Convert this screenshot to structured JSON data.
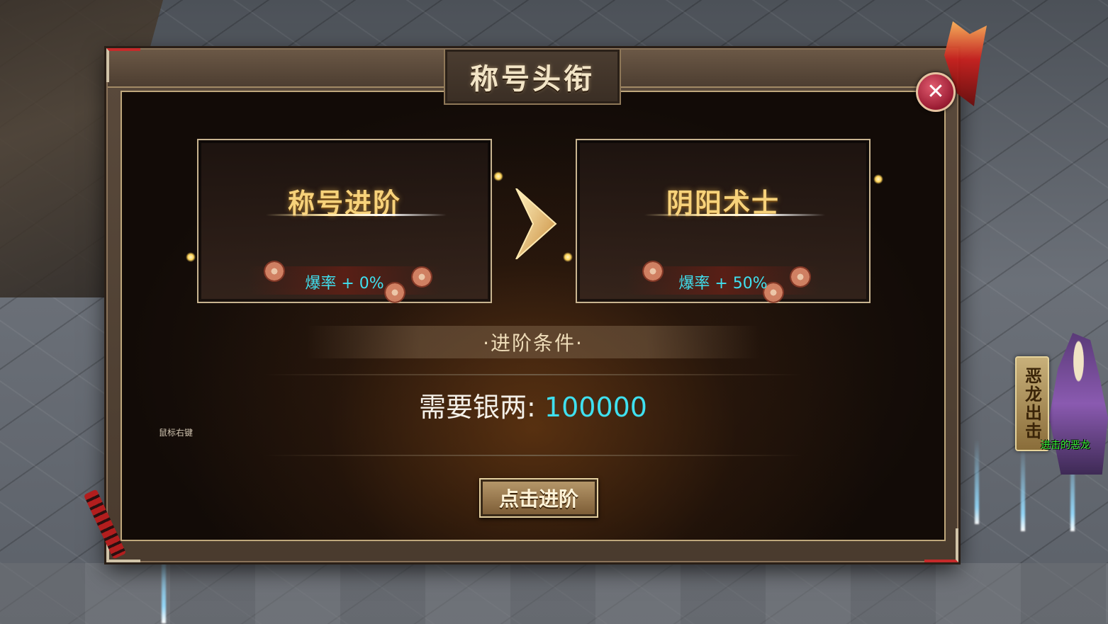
{
  "dialog": {
    "title": "称号头衔",
    "close_icon": "close-icon"
  },
  "cards": {
    "current": {
      "title": "称号进阶",
      "drop_rate": "爆率 + 0%"
    },
    "next": {
      "title": "阴阳术士",
      "drop_rate": "爆率 + 50%"
    }
  },
  "conditions": {
    "header": "·进阶条件·",
    "requirement_label": "需要银两:",
    "requirement_value": "100000"
  },
  "hint": "鼠标右键",
  "advance_button": "点击进阶",
  "event": {
    "badge_label": "恶龙出击",
    "caption": "进击的恶龙"
  },
  "colors": {
    "stat_cyan": "#3fe0ef",
    "title_gold": "#f7d27a",
    "event_green": "#3cf43c",
    "close_red": "#9a1c33"
  }
}
